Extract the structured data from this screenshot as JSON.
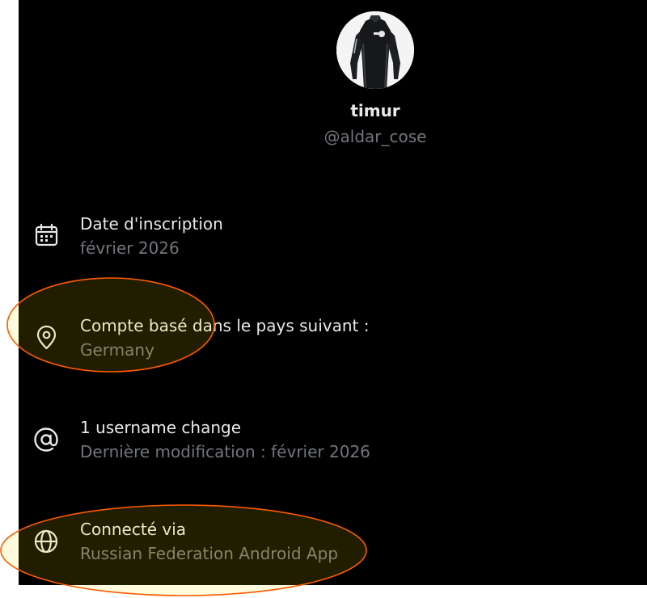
{
  "profile": {
    "display_name": "timur",
    "handle": "@aldar_cose",
    "avatar_icon": "wetsuit-avatar-image"
  },
  "rows": [
    {
      "icon": "calendar-icon",
      "title": "Date d'inscription",
      "subtitle": "février 2026"
    },
    {
      "icon": "location-pin-icon",
      "title": "Compte basé dans le pays suivant :",
      "subtitle": "Germany"
    },
    {
      "icon": "at-sign-icon",
      "title": "1 username change",
      "subtitle": "Dernière modification : février 2026"
    },
    {
      "icon": "globe-icon",
      "title": "Connecté via",
      "subtitle": "Russian Federation Android App"
    }
  ],
  "colors": {
    "background": "#000000",
    "primary_text": "#e7e9ea",
    "secondary_text": "#71767b",
    "highlight_stroke": "#ff5a00"
  }
}
